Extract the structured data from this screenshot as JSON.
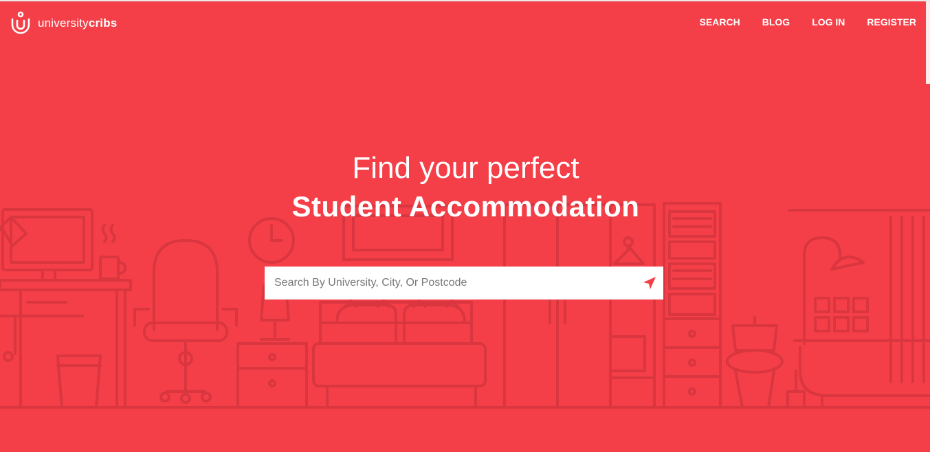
{
  "brand": {
    "name_light": "university",
    "name_bold": "cribs",
    "logo_icon": "university-cribs-logo-icon"
  },
  "nav": {
    "items": [
      {
        "label": "SEARCH"
      },
      {
        "label": "BLOG"
      },
      {
        "label": "LOG IN"
      },
      {
        "label": "REGISTER"
      }
    ]
  },
  "hero": {
    "line1": "Find your perfect",
    "line2": "Student Accommodation"
  },
  "search": {
    "placeholder": "Search By University, City, Or Postcode",
    "value": "",
    "action_icon": "location-arrow-icon"
  },
  "colors": {
    "background": "#f43f48",
    "illustration_stroke": "#d93640",
    "text": "#ffffff",
    "accent": "#f43f48"
  }
}
